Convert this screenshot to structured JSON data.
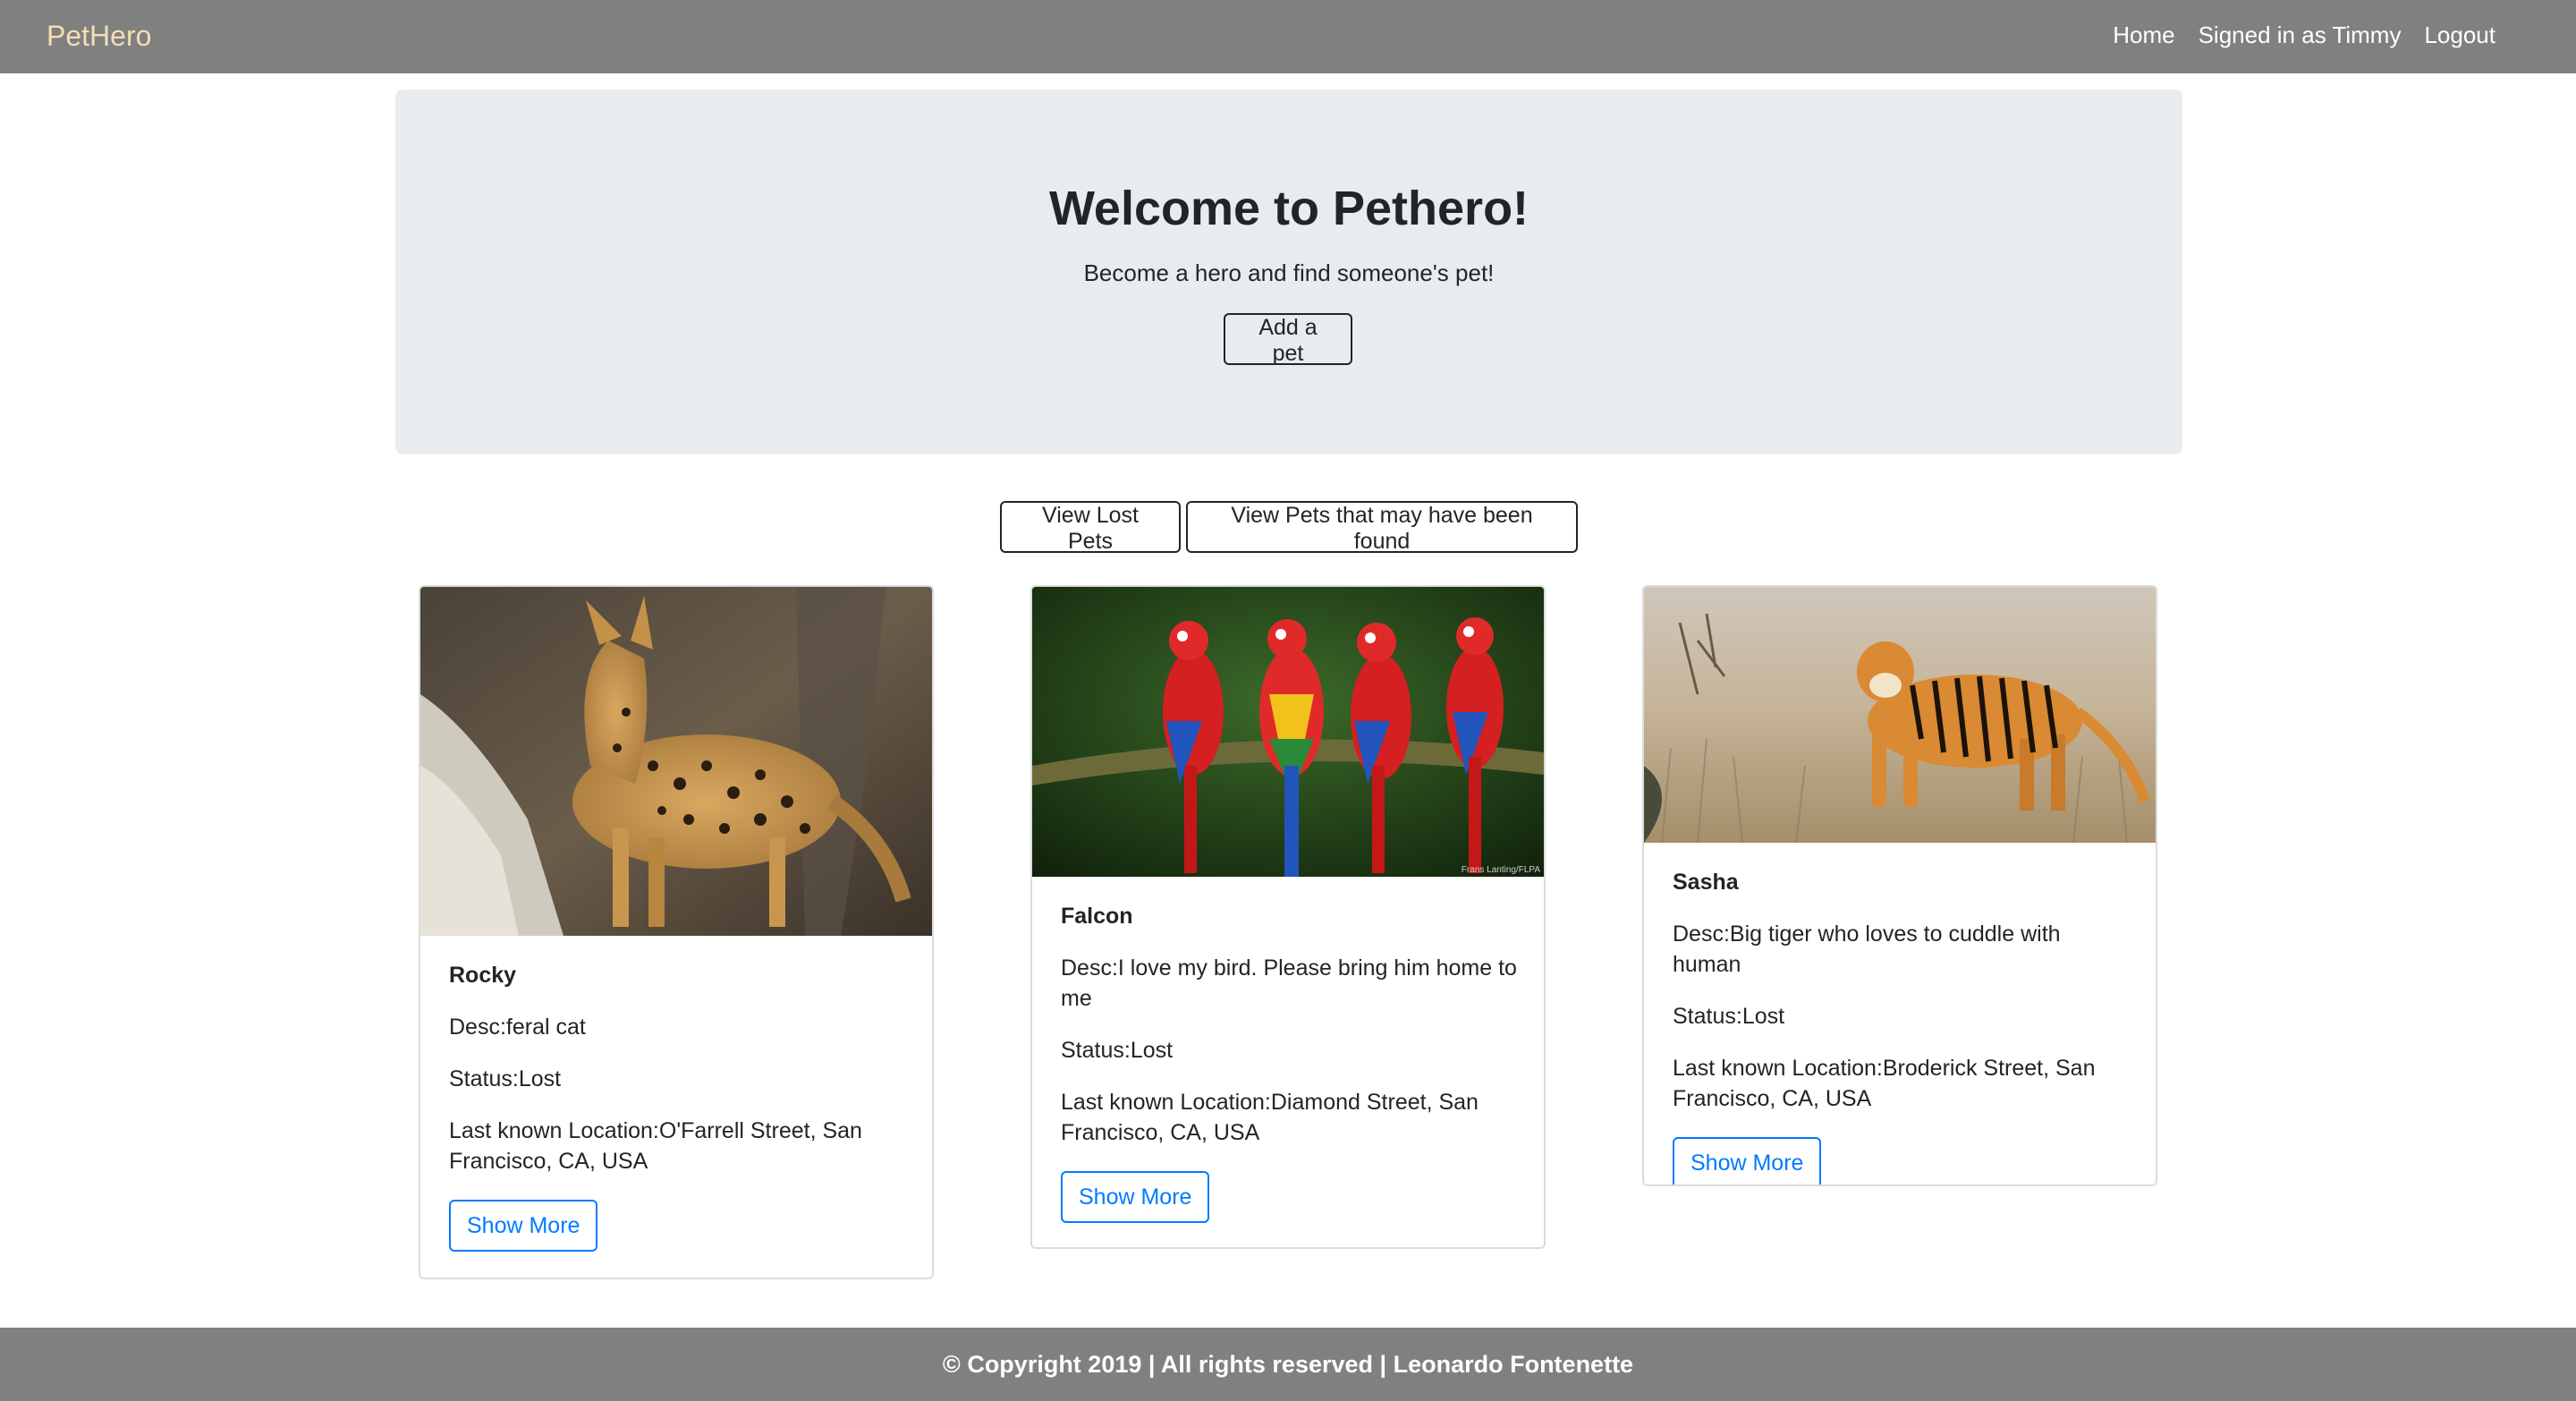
{
  "nav": {
    "brand": "PetHero",
    "links": [
      "Home",
      "Signed in as Timmy",
      "Logout"
    ]
  },
  "hero": {
    "title": "Welcome to Pethero!",
    "subtitle": "Become a hero and find someone's pet!",
    "add_button": "Add a pet"
  },
  "filters": {
    "lost": "View Lost Pets",
    "found": "View Pets that may have been found"
  },
  "pets": [
    {
      "name": "Rocky",
      "desc": "Desc:feral cat",
      "status": "Status:Lost",
      "location": "Last known Location:O'Farrell Street, San Francisco, CA, USA",
      "button": "Show More"
    },
    {
      "name": "Falcon",
      "desc": "Desc:I love my bird. Please bring him home to me",
      "status": "Status:Lost",
      "location": "Last known Location:Diamond Street, San Francisco, CA, USA",
      "button": "Show More",
      "photo_credit": "Frans Lanting/FLPA"
    },
    {
      "name": "Sasha",
      "desc": "Desc:Big tiger who loves to cuddle with human",
      "status": "Status:Lost",
      "location": "Last known Location:Broderick Street, San Francisco, CA, USA",
      "button": "Show More"
    }
  ],
  "footer": {
    "text": "© Copyright 2019 | All rights reserved | Leonardo Fontenette"
  }
}
